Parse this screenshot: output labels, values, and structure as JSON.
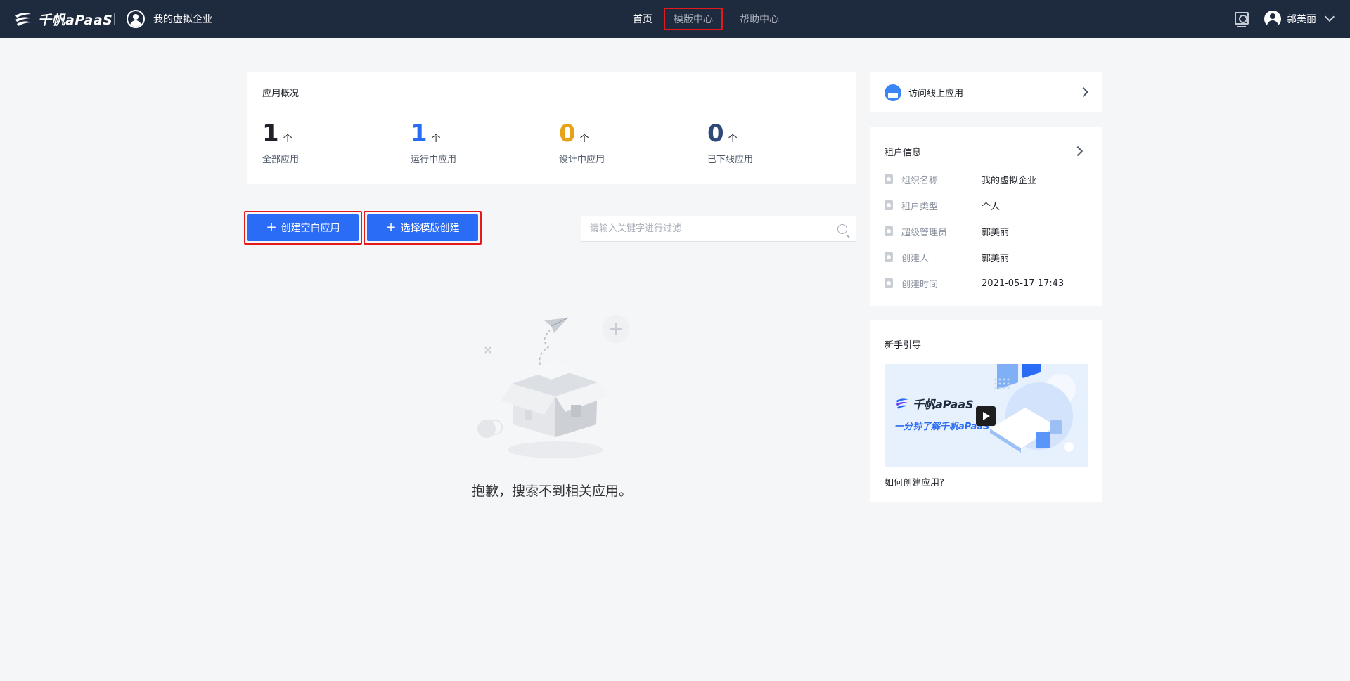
{
  "header": {
    "logo_text": "千帆aPaaS",
    "org_name": "我的虚拟企业",
    "nav": [
      {
        "label": "首页"
      },
      {
        "label": "模版中心"
      },
      {
        "label": "帮助中心"
      }
    ],
    "user_name": "郭美丽"
  },
  "overview": {
    "title": "应用概况",
    "stats": [
      {
        "value": "1",
        "unit": "个",
        "label": "全部应用",
        "color": "#1f2329"
      },
      {
        "value": "1",
        "unit": "个",
        "label": "运行中应用",
        "color": "#2b6cf6"
      },
      {
        "value": "0",
        "unit": "个",
        "label": "设计中应用",
        "color": "#e6a317"
      },
      {
        "value": "0",
        "unit": "个",
        "label": "已下线应用",
        "color": "#2f4a7a"
      }
    ]
  },
  "actions": {
    "create_blank": "创建空白应用",
    "create_from_template": "选择模版创建",
    "search_placeholder": "请输入关键字进行过滤"
  },
  "empty": {
    "message": "抱歉，搜索不到相关应用。"
  },
  "sidebar": {
    "visit_label": "访问线上应用",
    "tenant": {
      "title": "租户信息",
      "rows": [
        {
          "label": "组织名称",
          "value": "我的虚拟企业"
        },
        {
          "label": "租户类型",
          "value": "个人"
        },
        {
          "label": "超级管理员",
          "value": "郭美丽"
        },
        {
          "label": "创建人",
          "value": "郭美丽"
        },
        {
          "label": "创建时间",
          "value": "2021-05-17 17:43"
        }
      ]
    },
    "guide": {
      "title": "新手引导",
      "video_brand": "千帆aPaaS",
      "video_subtitle": "一分钟了解千帆aPaaS",
      "link": "如何创建应用?"
    }
  },
  "colors": {
    "nav_bg": "#1e2a3e",
    "primary": "#2b6cf6",
    "highlight_border": "#e5191c",
    "page_bg": "#f5f6f8"
  }
}
